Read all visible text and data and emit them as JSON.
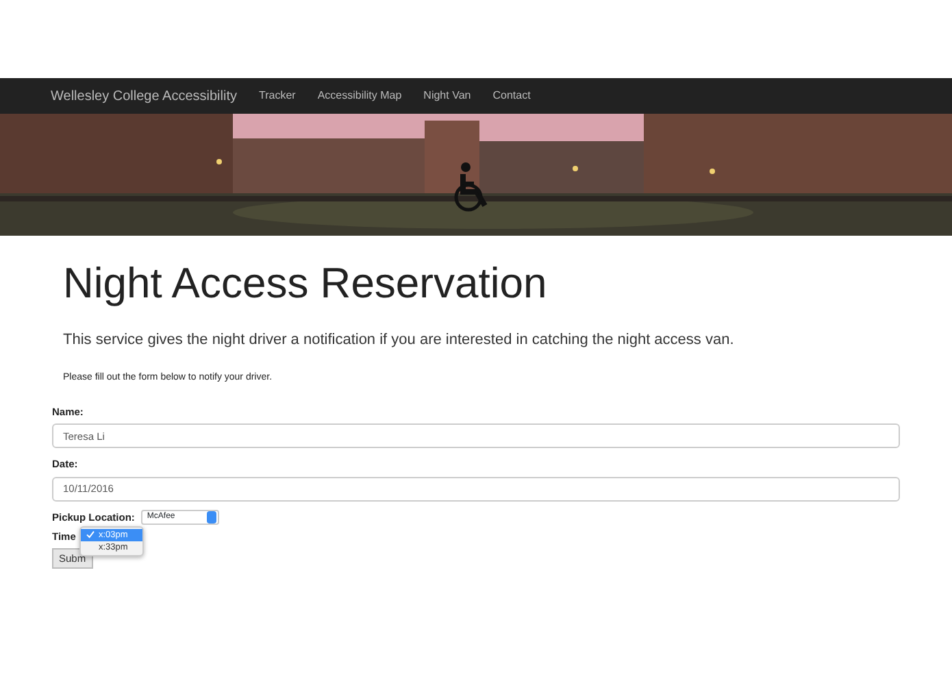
{
  "navbar": {
    "brand": "Wellesley College Accessibility",
    "links": [
      "Tracker",
      "Accessibility Map",
      "Night Van",
      "Contact"
    ]
  },
  "heading": "Night Access Reservation",
  "lead": "This service gives the night driver a notification if you are interested in catching the night access van.",
  "instructions": "Please fill out the form below to notify your driver.",
  "form": {
    "name": {
      "label": "Name:",
      "value": "Teresa Li"
    },
    "date": {
      "label": "Date:",
      "value": "10/11/2016"
    },
    "pickup": {
      "label": "Pickup Location:",
      "value": "McAfee"
    },
    "time": {
      "label": "Time",
      "options": [
        {
          "label": "x:03pm",
          "selected": true
        },
        {
          "label": "x:33pm",
          "selected": false
        }
      ]
    },
    "submit": "Subm"
  }
}
